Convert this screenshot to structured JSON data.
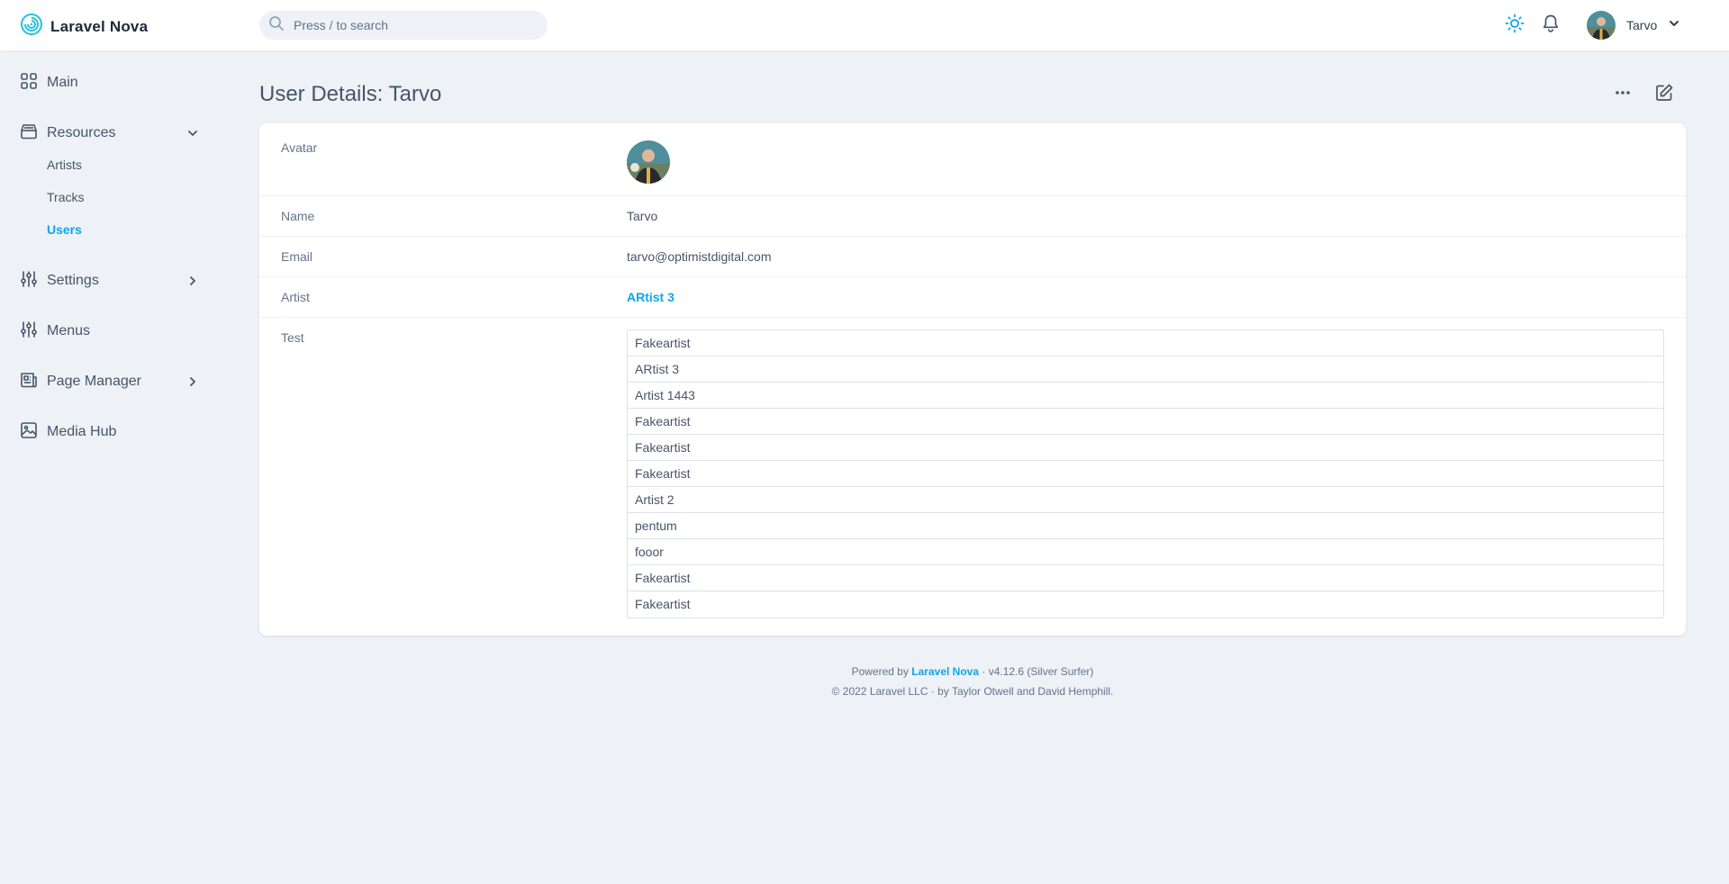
{
  "app": {
    "brand": "Laravel Nova"
  },
  "search": {
    "placeholder": "Press / to search"
  },
  "user": {
    "name": "Tarvo"
  },
  "sidebar": {
    "main": "Main",
    "resources": "Resources",
    "resource_items": [
      "Artists",
      "Tracks",
      "Users"
    ],
    "settings": "Settings",
    "menus": "Menus",
    "page_manager": "Page Manager",
    "media_hub": "Media Hub"
  },
  "page": {
    "title": "User Details: Tarvo",
    "fields": {
      "avatar_label": "Avatar",
      "name_label": "Name",
      "name_value": "Tarvo",
      "email_label": "Email",
      "email_value": "tarvo@optimistdigital.com",
      "artist_label": "Artist",
      "artist_value": "ARtist 3",
      "test_label": "Test"
    },
    "test_items": [
      "Fakeartist",
      "ARtist 3",
      "Artist 1443",
      "Fakeartist",
      "Fakeartist",
      "Fakeartist",
      "Artist 2",
      "pentum",
      "fooor",
      "Fakeartist",
      "Fakeartist"
    ]
  },
  "footer": {
    "powered_prefix": "Powered by",
    "powered_link": "Laravel Nova",
    "version": "· v4.12.6 (Silver Surfer)",
    "copyright": "© 2022 Laravel LLC · by Taylor Otwell and David Hemphill."
  },
  "colors": {
    "accent": "#0ea5e9",
    "background": "#eef1f6",
    "text": "#475569"
  },
  "icons": [
    "nova-logo-icon",
    "search-icon",
    "sun-icon",
    "bell-icon",
    "chevron-down-icon",
    "grid-icon",
    "archive-icon",
    "sliders-icon",
    "chevron-right-icon",
    "newspaper-icon",
    "image-icon",
    "ellipsis-icon",
    "edit-icon"
  ]
}
